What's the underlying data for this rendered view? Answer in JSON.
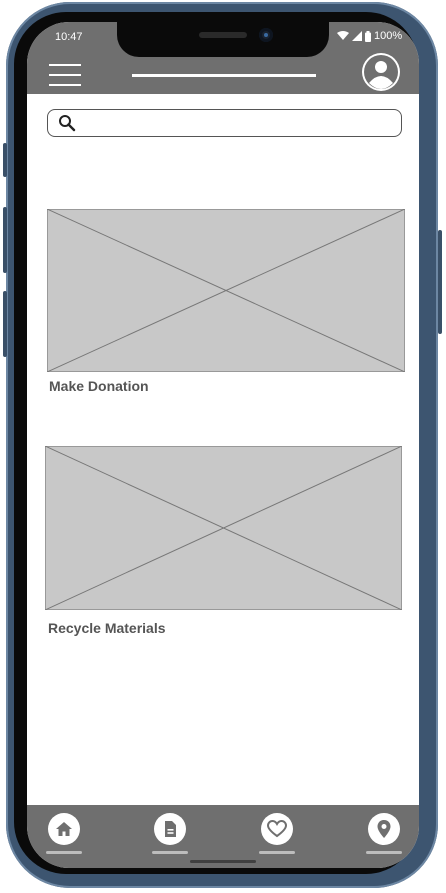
{
  "status_bar": {
    "time": "10:47",
    "battery": "100%"
  },
  "search": {
    "placeholder": "",
    "value": ""
  },
  "cards": [
    {
      "label": "Make Donation"
    },
    {
      "label": "Recycle Materials"
    }
  ],
  "bottom_nav": {
    "items": [
      {
        "icon": "home-icon"
      },
      {
        "icon": "document-icon"
      },
      {
        "icon": "heart-icon"
      },
      {
        "icon": "location-pin-icon"
      }
    ]
  },
  "colors": {
    "bar": "#6f6f6f",
    "placeholder_image": "#c8c8c8",
    "label_text": "#555555",
    "frame": "#3d5570"
  }
}
